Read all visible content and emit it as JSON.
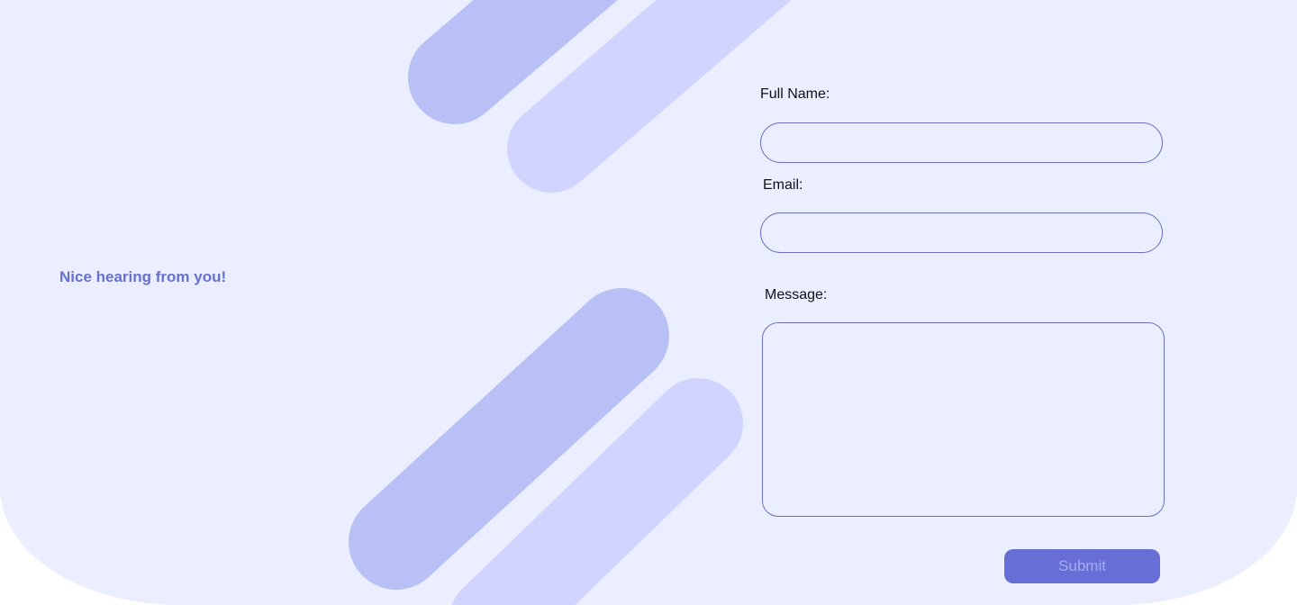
{
  "hero": {
    "tagline": "Nice hearing from you!"
  },
  "form": {
    "full_name_label": "Full Name:",
    "full_name_value": "",
    "email_label": "Email:",
    "email_value": "",
    "message_label": "Message:",
    "message_value": "",
    "submit_label": "Submit"
  },
  "colors": {
    "background": "#eaeeff",
    "accent": "#676ed6",
    "tagline": "#6670cf",
    "stripe_dark": "#b9c0f6",
    "stripe_light": "#d0d4fe",
    "field_border": "#6a70c4"
  }
}
